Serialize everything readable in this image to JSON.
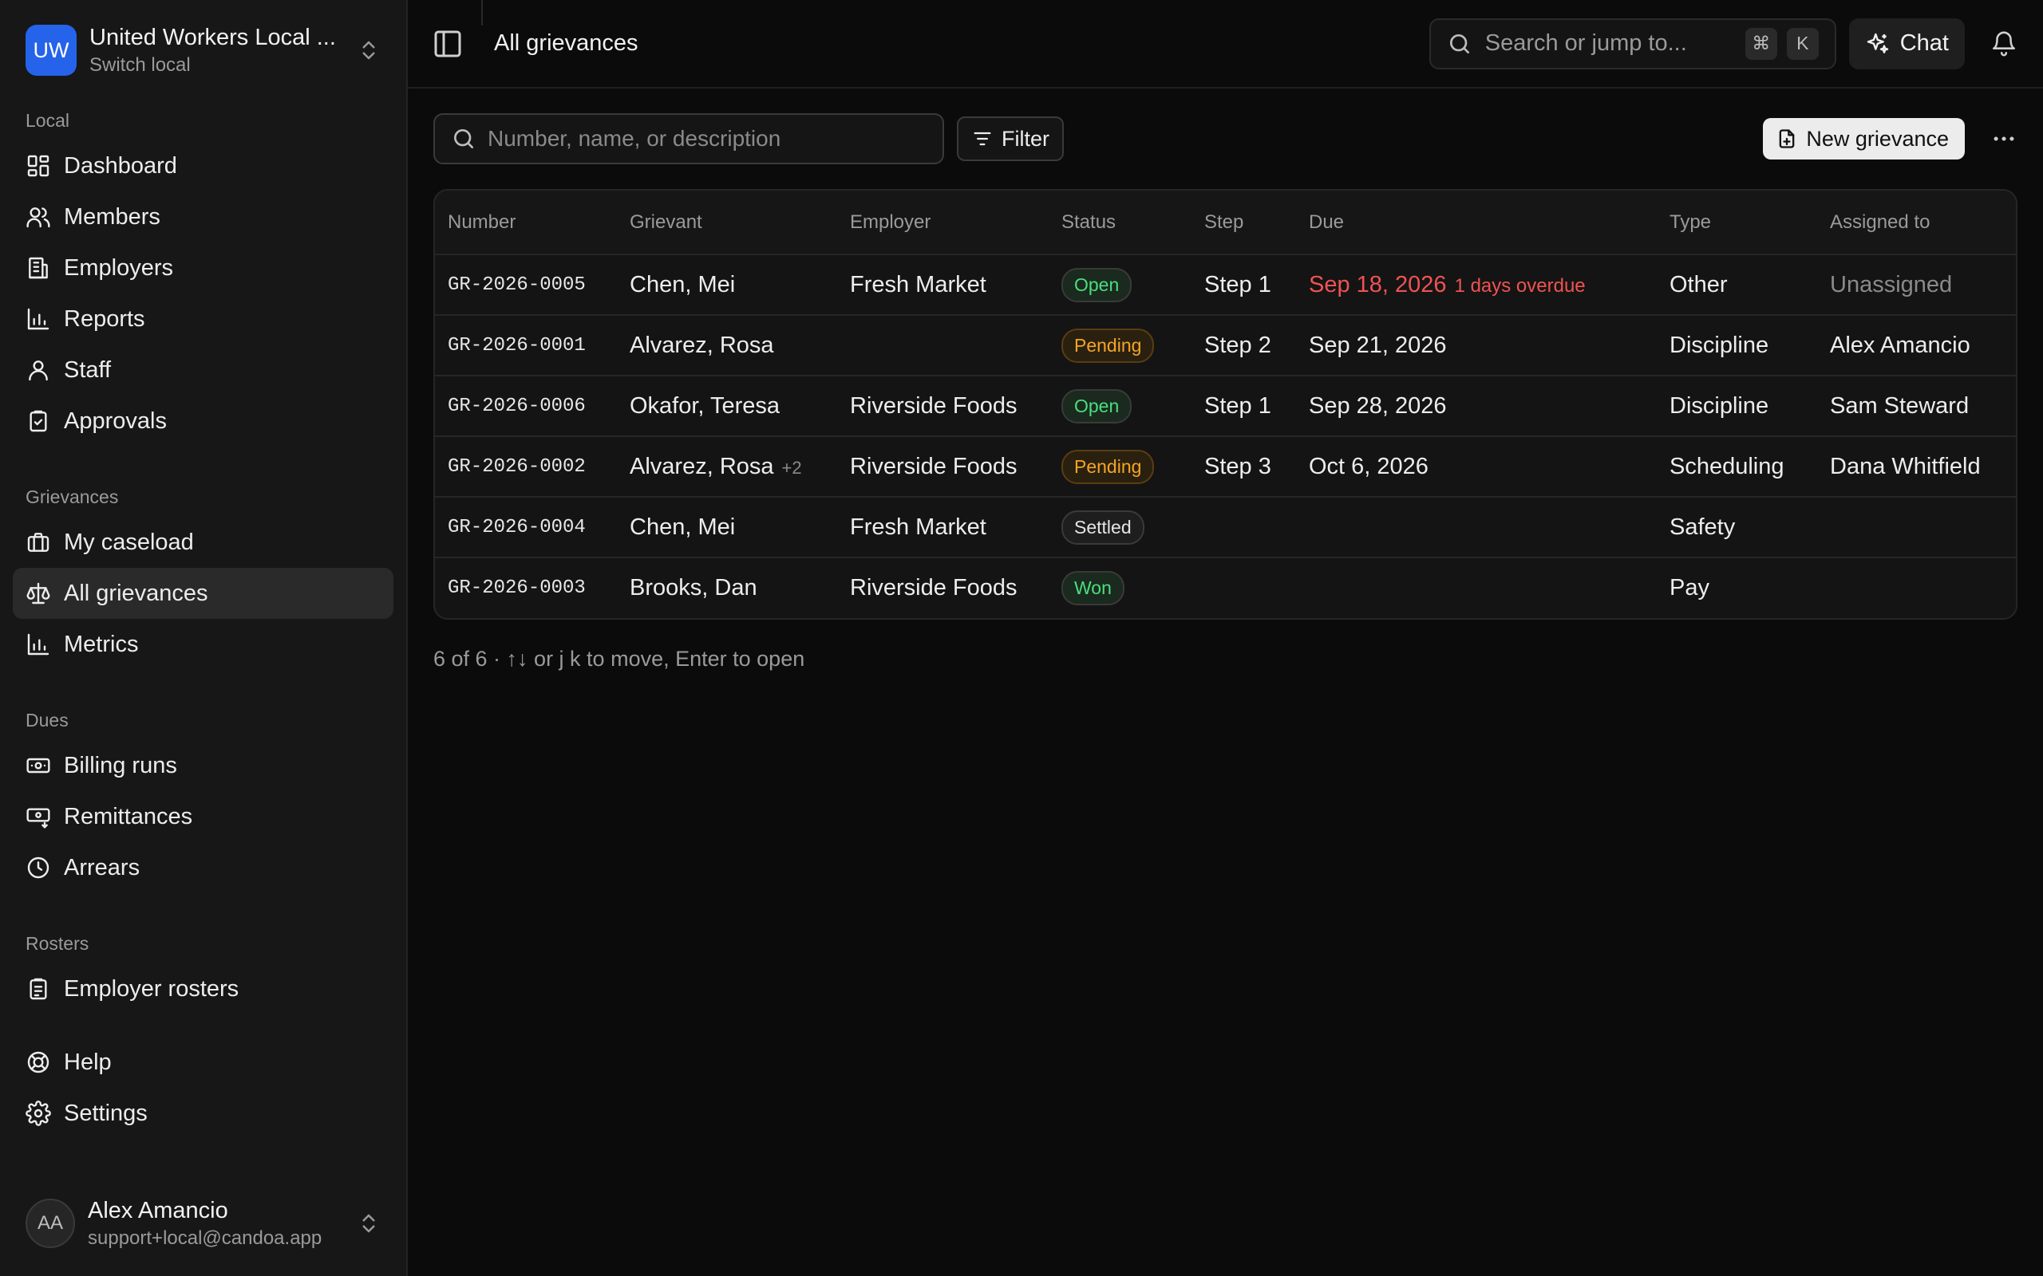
{
  "org": {
    "initials": "UW",
    "name": "United Workers Local ...",
    "subtitle": "Switch local"
  },
  "sidebar": {
    "sections": [
      {
        "label": "Local",
        "items": [
          {
            "label": "Dashboard",
            "icon": "dashboard-icon"
          },
          {
            "label": "Members",
            "icon": "members-icon"
          },
          {
            "label": "Employers",
            "icon": "building-icon"
          },
          {
            "label": "Reports",
            "icon": "bar-chart-icon"
          },
          {
            "label": "Staff",
            "icon": "user-icon"
          },
          {
            "label": "Approvals",
            "icon": "clipboard-check-icon"
          }
        ]
      },
      {
        "label": "Grievances",
        "items": [
          {
            "label": "My caseload",
            "icon": "briefcase-icon"
          },
          {
            "label": "All grievances",
            "icon": "scale-icon",
            "active": true
          },
          {
            "label": "Metrics",
            "icon": "bar-chart-icon"
          }
        ]
      },
      {
        "label": "Dues",
        "items": [
          {
            "label": "Billing runs",
            "icon": "banknote-icon"
          },
          {
            "label": "Remittances",
            "icon": "banknote-arrow-icon"
          },
          {
            "label": "Arrears",
            "icon": "clock-icon"
          }
        ]
      },
      {
        "label": "Rosters",
        "items": [
          {
            "label": "Employer rosters",
            "icon": "clipboard-list-icon"
          }
        ]
      }
    ],
    "bottom_items": [
      {
        "label": "Help",
        "icon": "lifebuoy-icon"
      },
      {
        "label": "Settings",
        "icon": "gear-icon"
      }
    ]
  },
  "user": {
    "initials": "AA",
    "name": "Alex Amancio",
    "email": "support+local@candoa.app"
  },
  "header": {
    "breadcrumb": "All grievances",
    "search_placeholder": "Search or jump to...",
    "shortcut_keys": [
      "⌘",
      "K"
    ],
    "chat_label": "Chat"
  },
  "toolbar": {
    "search_placeholder": "Number, name, or description",
    "filter_label": "Filter",
    "new_label": "New grievance"
  },
  "table": {
    "columns": [
      "Number",
      "Grievant",
      "Employer",
      "Status",
      "Step",
      "Due",
      "Type",
      "Assigned to"
    ],
    "rows": [
      {
        "number": "GR-2026-0005",
        "grievant": "Chen, Mei",
        "extra": "",
        "employer": "Fresh Market",
        "status": "Open",
        "step": "Step 1",
        "due": "Sep 18, 2026",
        "overdue": "1 days overdue",
        "type": "Other",
        "assigned": "Unassigned"
      },
      {
        "number": "GR-2026-0001",
        "grievant": "Alvarez, Rosa",
        "extra": "",
        "employer": "",
        "status": "Pending",
        "step": "Step 2",
        "due": "Sep 21, 2026",
        "overdue": "",
        "type": "Discipline",
        "assigned": "Alex Amancio"
      },
      {
        "number": "GR-2026-0006",
        "grievant": "Okafor, Teresa",
        "extra": "",
        "employer": "Riverside Foods",
        "status": "Open",
        "step": "Step 1",
        "due": "Sep 28, 2026",
        "overdue": "",
        "type": "Discipline",
        "assigned": "Sam Steward"
      },
      {
        "number": "GR-2026-0002",
        "grievant": "Alvarez, Rosa",
        "extra": "+2",
        "employer": "Riverside Foods",
        "status": "Pending",
        "step": "Step 3",
        "due": "Oct 6, 2026",
        "overdue": "",
        "type": "Scheduling",
        "assigned": "Dana Whitfield"
      },
      {
        "number": "GR-2026-0004",
        "grievant": "Chen, Mei",
        "extra": "",
        "employer": "Fresh Market",
        "status": "Settled",
        "step": "",
        "due": "",
        "overdue": "",
        "type": "Safety",
        "assigned": ""
      },
      {
        "number": "GR-2026-0003",
        "grievant": "Brooks, Dan",
        "extra": "",
        "employer": "Riverside Foods",
        "status": "Won",
        "step": "",
        "due": "",
        "overdue": "",
        "type": "Pay",
        "assigned": ""
      }
    ]
  },
  "status_colors": {
    "Open": {
      "text": "#4ade80",
      "border": "#3a3a3a",
      "bg": "#1a2a1e"
    },
    "Pending": {
      "text": "#f5a524",
      "border": "#5a3d12",
      "bg": "#2a2010"
    },
    "Settled": {
      "text": "#e5e5e5",
      "border": "#3a3a3a",
      "bg": "#1e1e1e"
    },
    "Won": {
      "text": "#4ade80",
      "border": "#3a3a3a",
      "bg": "#1a2a1e"
    }
  },
  "footer_hint": "6 of 6 · ↑↓ or j k to move, Enter to open"
}
